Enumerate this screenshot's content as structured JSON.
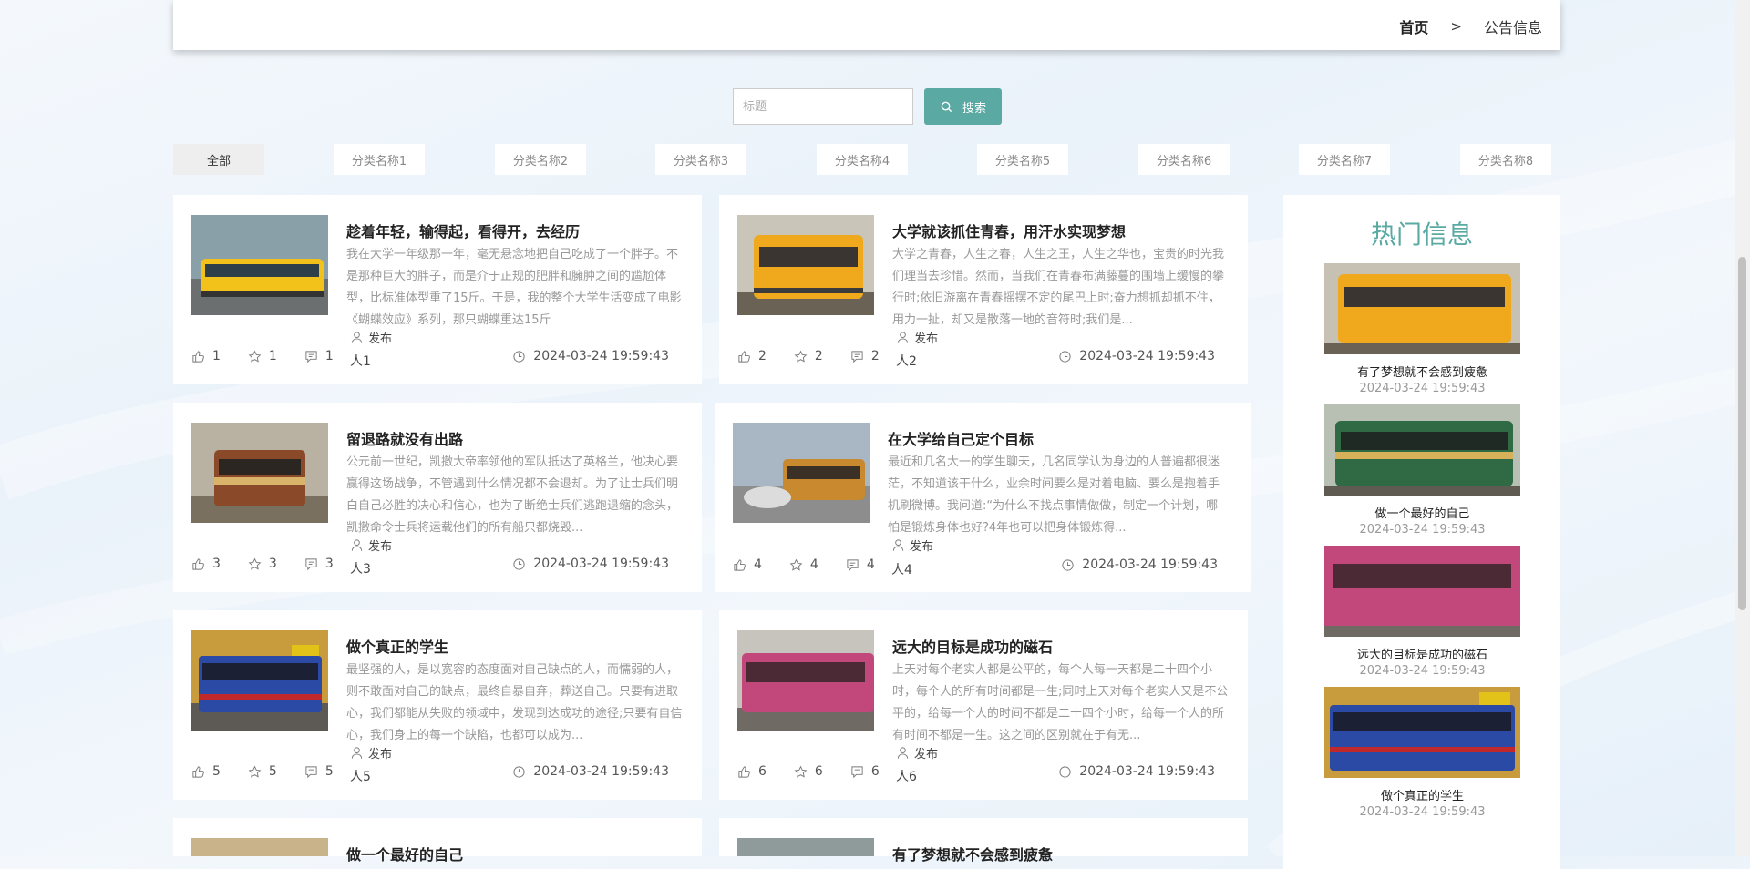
{
  "breadcrumb": {
    "home": "首页",
    "separator": ">",
    "current": "公告信息"
  },
  "search": {
    "placeholder": "标题",
    "button_label": "搜索"
  },
  "categories": [
    "全部",
    "分类名称1",
    "分类名称2",
    "分类名称3",
    "分类名称4",
    "分类名称5",
    "分类名称6",
    "分类名称7",
    "分类名称8"
  ],
  "publish_label": "发布",
  "posts": [
    {
      "title": "趁着年轻，输得起，看得开，去经历",
      "desc": "我在大学一年级那一年，毫无悬念地把自己吃成了一个胖子。不是那种巨大的胖子，而是介于正规的肥胖和臃肿之间的尴尬体型，比标准体型重了15斤。于是，我的整个大学生活变成了电影《蝴蝶效应》系列，那只蝴蝶重达15斤",
      "likes": "1",
      "favorites": "1",
      "comments": "1",
      "author": "人1",
      "time": "2024-03-24 19:59:43"
    },
    {
      "title": "大学就该抓住青春，用汗水实现梦想",
      "desc": "大学之青春，人生之春，人生之王，人生之华也，宝贵的时光我们理当去珍惜。然而，当我们在青春布满藤蔓的围墙上缓慢的攀行时;依旧游离在青春摇摆不定的尾巴上时;奋力想抓却抓不住，用力一扯，却又是散落一地的音符时;我们是...",
      "likes": "2",
      "favorites": "2",
      "comments": "2",
      "author": "人2",
      "time": "2024-03-24 19:59:43"
    },
    {
      "title": "留退路就没有出路",
      "desc": "公元前一世纪，凯撒大帝率领他的军队抵达了英格兰，他决心要赢得这场战争，不管遇到什么情况都不会退却。为了让士兵们明白自己必胜的决心和信心，也为了断绝士兵们逃跑退缩的念头，凯撒命令士兵将运载他们的所有船只都烧毁...",
      "likes": "3",
      "favorites": "3",
      "comments": "3",
      "author": "人3",
      "time": "2024-03-24 19:59:43"
    },
    {
      "title": "在大学给自己定个目标",
      "desc": "最近和几名大一的学生聊天，几名同学认为身边的人普遍都很迷茫，不知道该干什么，业余时间要么是对着电脑、要么是抱着手机刷微博。我问道:“为什么不找点事情做做，制定一个计划，哪怕是锻炼身体也好?4年也可以把身体锻炼得...",
      "likes": "4",
      "favorites": "4",
      "comments": "4",
      "author": "人4",
      "time": "2024-03-24 19:59:43"
    },
    {
      "title": "做个真正的学生",
      "desc": "最坚强的人，是以宽容的态度面对自己缺点的人，而懦弱的人，则不敢面对自己的缺点，最终自暴自弃，葬送自己。只要有进取心，我们都能从失败的领域中，发现到达成功的途径;只要有自信心，我们身上的每一个缺陷，也都可以成为...",
      "likes": "5",
      "favorites": "5",
      "comments": "5",
      "author": "人5",
      "time": "2024-03-24 19:59:43"
    },
    {
      "title": "远大的目标是成功的磁石",
      "desc": "上天对每个老实人都是公平的，每个人每一天都是二十四个小时，每个人的所有时间都是一生;同时上天对每个老实人又是不公平的，给每一个人的时间不都是二十四个小时，给每一个人的所有时间不都是一生。这之间的区别就在于有无...",
      "likes": "6",
      "favorites": "6",
      "comments": "6",
      "author": "人6",
      "time": "2024-03-24 19:59:43"
    },
    {
      "title": "做一个最好的自己",
      "desc": "",
      "likes": "",
      "favorites": "",
      "comments": "",
      "author": "",
      "time": ""
    },
    {
      "title": "有了梦想就不会感到疲惫",
      "desc": "",
      "likes": "",
      "favorites": "",
      "comments": "",
      "author": "",
      "time": ""
    }
  ],
  "hot": {
    "title": "热门信息",
    "items": [
      {
        "title": "有了梦想就不会感到疲惫",
        "time": "2024-03-24 19:59:43"
      },
      {
        "title": "做一个最好的自己",
        "time": "2024-03-24 19:59:43"
      },
      {
        "title": "远大的目标是成功的磁石",
        "time": "2024-03-24 19:59:43"
      },
      {
        "title": "做个真正的学生",
        "time": "2024-03-24 19:59:43"
      }
    ]
  },
  "colors": {
    "accent": "#5aa9a3",
    "card_bg": "#ffffff",
    "muted_text": "#999999"
  },
  "icons": {
    "like": "thumbs-up-icon",
    "favorite": "star-icon",
    "comment": "comment-icon",
    "publish": "user-icon",
    "time": "clock-icon",
    "search": "search-icon"
  }
}
